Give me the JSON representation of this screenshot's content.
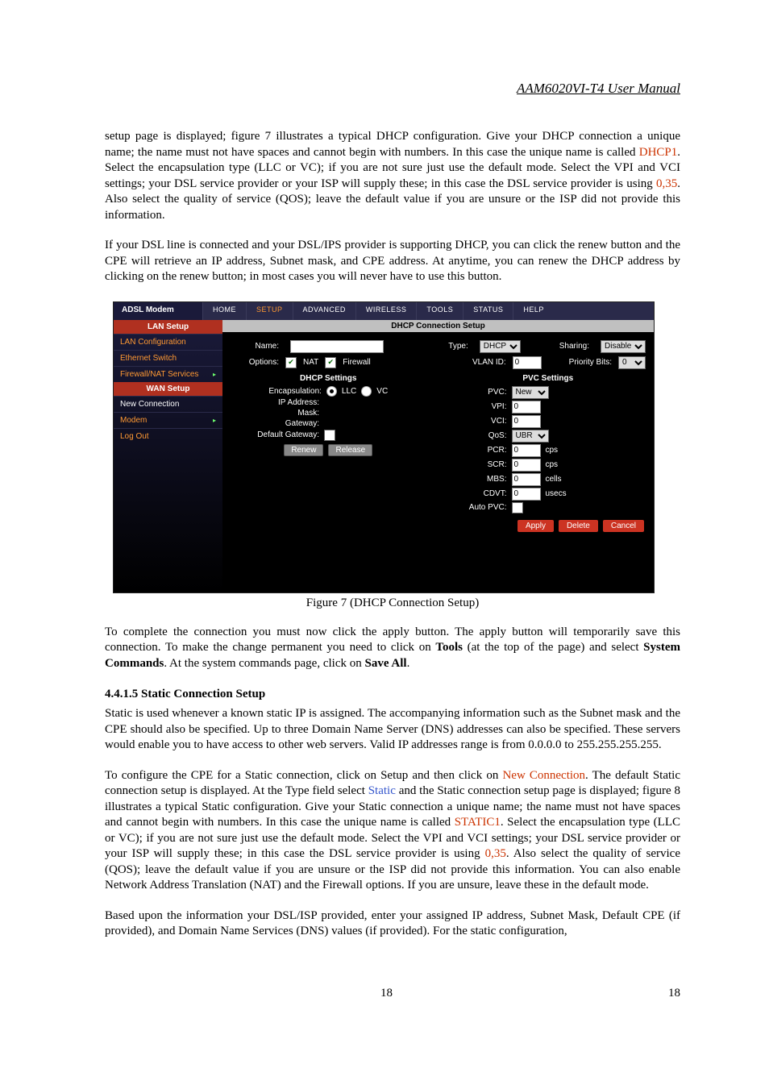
{
  "header": {
    "title": "AAM6020VI-T4 User Manual"
  },
  "para1": {
    "text_a": "setup page is displayed; figure 7 illustrates a typical DHCP configuration.  Give your DHCP connection a unique name; the name must not have spaces and cannot begin with numbers.  In this case the unique name is called ",
    "hl1": "DHCP1",
    "text_b": ".  Select the encapsulation type (LLC or VC); if you are not sure just use the default mode.  Select the VPI and VCI settings; your DSL service provider or your ISP will supply these; in this case the DSL service provider is using ",
    "hl2": "0,35",
    "text_c": ".  Also select the quality of service (QOS); leave the default value if you are unsure or the ISP did not provide this information."
  },
  "para2": "If your DSL line is connected and your DSL/IPS provider is supporting DHCP, you can click the renew button and the CPE will retrieve an IP address, Subnet mask, and CPE address.  At anytime, you can renew the DHCP address by clicking on the renew button; in most cases you will never have to use this button.",
  "modem": {
    "logo": "ADSL Modem",
    "tabs": [
      "HOME",
      "SETUP",
      "ADVANCED",
      "WIRELESS",
      "TOOLS",
      "STATUS",
      "HELP"
    ],
    "panel_title": "DHCP Connection Setup",
    "sidebar": {
      "lan_setup_head": "LAN Setup",
      "lan_config": "LAN Configuration",
      "eth_switch": "Ethernet Switch",
      "firewall_nat": "Firewall/NAT Services",
      "wan_setup_head": "WAN Setup",
      "new_conn": "New Connection",
      "modem_item": "Modem",
      "logout": "Log Out"
    },
    "form": {
      "name_label": "Name:",
      "name_value": "",
      "type_label": "Type:",
      "type_value": "DHCP",
      "sharing_label": "Sharing:",
      "sharing_value": "Disable",
      "options_label": "Options:",
      "nat_label": "NAT",
      "firewall_label": "Firewall",
      "vlan_label": "VLAN ID:",
      "vlan_value": "0",
      "prio_label": "Priority Bits:",
      "prio_value": "0"
    },
    "dhcp_col": {
      "title": "DHCP Settings",
      "encap_label": "Encapsulation:",
      "encap_llc": "LLC",
      "encap_vc": "VC",
      "ip_label": "IP Address:",
      "mask_label": "Mask:",
      "gw_label": "Gateway:",
      "def_gw_label": "Default Gateway:",
      "renew_btn": "Renew",
      "release_btn": "Release"
    },
    "pvc_col": {
      "title": "PVC Settings",
      "pvc_label": "PVC:",
      "pvc_value": "New",
      "vpi_label": "VPI:",
      "vpi_value": "0",
      "vci_label": "VCI:",
      "vci_value": "0",
      "qos_label": "QoS:",
      "qos_value": "UBR",
      "pcr_label": "PCR:",
      "pcr_value": "0",
      "pcr_unit": "cps",
      "scr_label": "SCR:",
      "scr_value": "0",
      "scr_unit": "cps",
      "mbs_label": "MBS:",
      "mbs_value": "0",
      "mbs_unit": "cells",
      "cdvt_label": "CDVT:",
      "cdvt_value": "0",
      "cdvt_unit": "usecs",
      "autopvc_label": "Auto PVC:"
    },
    "actions": {
      "apply": "Apply",
      "delete": "Delete",
      "cancel": "Cancel"
    }
  },
  "figure_caption": "Figure 7 (DHCP Connection Setup)",
  "para3": {
    "text_a": "To complete the connection you must now click the apply button.  The apply button will temporarily save this connection. To make the change permanent you need to click on ",
    "b1": "Tools",
    "text_b": " (at the top of the page) and select ",
    "b2": "System Commands",
    "text_c": ".  At the system commands page, click on ",
    "b3": "Save All",
    "text_d": "."
  },
  "sect_heading": "4.4.1.5  Static Connection Setup",
  "para4": "Static is used whenever a known static IP is assigned. The accompanying information such as the Subnet mask and the CPE should also be specified. Up to three Domain Name Server (DNS) addresses can also be specified. These servers would enable you to have access to other web servers. Valid IP addresses range is from 0.0.0.0 to 255.255.255.255.",
  "para5": {
    "text_a": "To configure the CPE for a Static connection, click on Setup and then click on ",
    "hl1": "New Connection",
    "text_b": ".  The default Static connection setup is displayed.  At the Type field select ",
    "hl2": "Static",
    "text_c": " and the Static connection setup page is displayed; figure 8 illustrates a typical Static configuration.  Give your Static connection a unique name; the name must not have spaces and cannot begin with numbers.  In this case the unique name is called ",
    "hl3": "STATIC1",
    "text_d": ".  Select the encapsulation type (LLC or VC); if you are not sure just use the default mode.  Select the VPI and VCI settings; your DSL service provider or your ISP will supply these; in this case the DSL service provider is using ",
    "hl4": "0,35",
    "text_e": ".  Also select the quality of service (QOS); leave the default value if you are unsure or the ISP did not provide this information.   You can also enable Network Address Translation (NAT) and the Firewall options.  If you are unsure, leave these in the default mode."
  },
  "para6": "Based upon the information your DSL/ISP provided, enter your assigned IP address, Subnet Mask, Default CPE (if provided), and Domain Name Services (DNS) values (if provided).  For the static configuration,",
  "footer": {
    "left": "18",
    "right": "18"
  }
}
